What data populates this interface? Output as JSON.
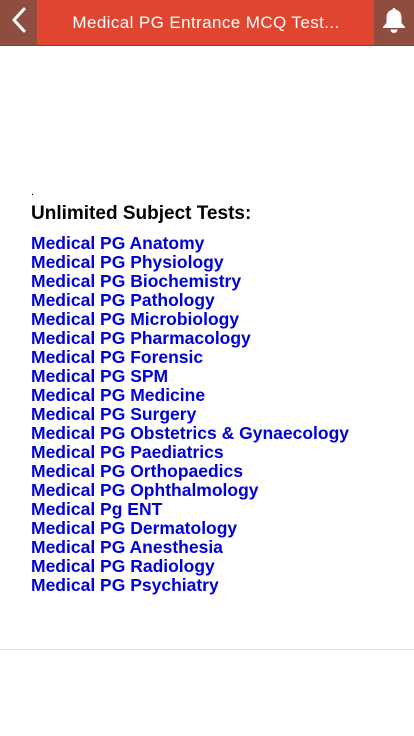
{
  "header": {
    "title": "Medical PG Entrance MCQ Test...",
    "back_icon": "chevron-left-icon",
    "notification_icon": "bell-icon",
    "bar_color": "#e0452f",
    "button_color": "#8f4d40"
  },
  "content": {
    "dot": ".",
    "heading": "Unlimited Subject Tests:",
    "link_color": "#0000d8",
    "links": [
      "Medical PG Anatomy",
      "Medical PG Physiology",
      "Medical PG Biochemistry",
      "Medical PG Pathology",
      "Medical PG Microbiology",
      "Medical PG Pharmacology",
      "Medical PG Forensic",
      "Medical PG SPM",
      "Medical PG Medicine",
      "Medical PG Surgery",
      "Medical PG Obstetrics & Gynaecology",
      "Medical PG Paediatrics",
      "Medical PG Orthopaedics",
      "Medical PG Ophthalmology",
      "Medical Pg ENT",
      "Medical PG Dermatology",
      "Medical PG Anesthesia",
      "Medical PG Radiology",
      "Medical PG Psychiatry"
    ]
  }
}
